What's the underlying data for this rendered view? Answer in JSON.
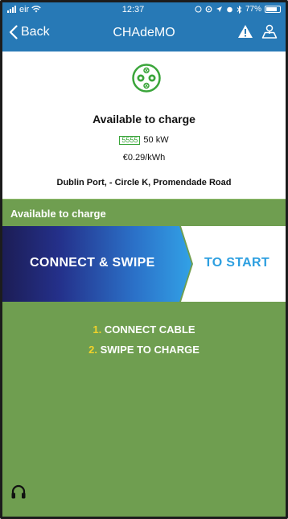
{
  "status_bar": {
    "carrier": "eir",
    "time": "12:37",
    "battery_percent": "77%"
  },
  "nav": {
    "back_label": "Back",
    "title": "CHAdeMO"
  },
  "charger": {
    "status_title": "Available to charge",
    "power_glyph": "5555",
    "power": "50 kW",
    "price": "€0.29/kWh",
    "address": "Dublin Port, - Circle K, Promendade Road"
  },
  "status_strip": {
    "label": "Available to charge"
  },
  "banner": {
    "left_text": "CONNECT & SWIPE",
    "right_text": "TO START"
  },
  "steps": [
    {
      "num": "1.",
      "text": "CONNECT CABLE"
    },
    {
      "num": "2.",
      "text": "SWIPE TO CHARGE"
    }
  ],
  "colors": {
    "nav_blue": "#2779b6",
    "available_green": "#6f9e50",
    "step_yellow": "#f2d22a",
    "brand_cyan": "#2d9fe0",
    "plug_green": "#3aa53a"
  },
  "icons": {
    "warning": "warning-triangle-icon",
    "map": "map-user-icon",
    "plug": "chademo-plug-icon",
    "support": "headset-icon"
  }
}
